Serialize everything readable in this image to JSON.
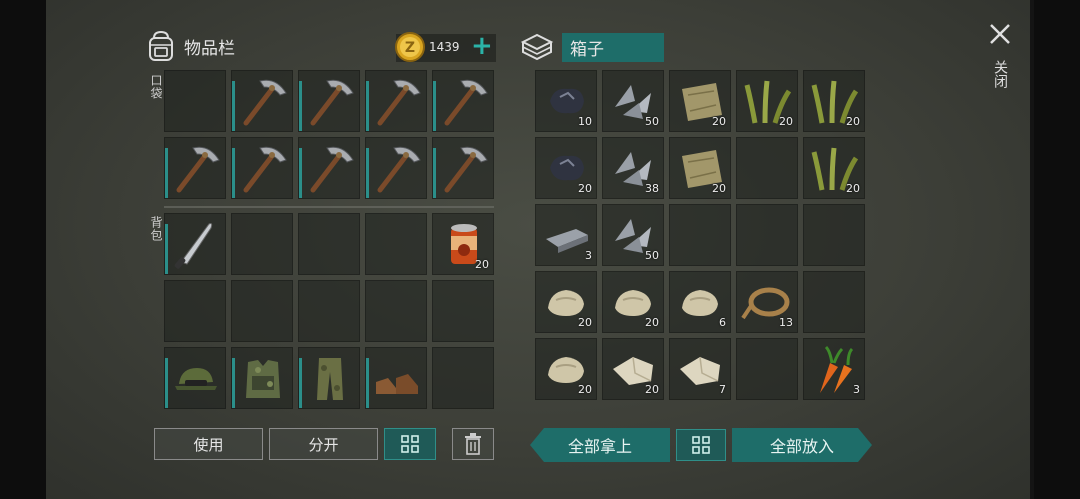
{
  "inventory": {
    "title": "物品栏",
    "currency_amount": "1439",
    "pocket_label": "口袋",
    "backpack_label": "背包",
    "pocket_slots": [
      {
        "item": "empty",
        "qty": ""
      },
      {
        "item": "pickaxe",
        "qty": ""
      },
      {
        "item": "pickaxe",
        "qty": ""
      },
      {
        "item": "pickaxe",
        "qty": ""
      },
      {
        "item": "pickaxe",
        "qty": ""
      },
      {
        "item": "pickaxe",
        "qty": ""
      },
      {
        "item": "pickaxe",
        "qty": ""
      },
      {
        "item": "pickaxe",
        "qty": ""
      },
      {
        "item": "pickaxe",
        "qty": ""
      },
      {
        "item": "pickaxe",
        "qty": ""
      }
    ],
    "backpack_slots": [
      {
        "item": "machete",
        "qty": ""
      },
      {
        "item": "empty",
        "qty": ""
      },
      {
        "item": "empty",
        "qty": ""
      },
      {
        "item": "empty",
        "qty": ""
      },
      {
        "item": "canned-food",
        "qty": "20"
      },
      {
        "item": "empty",
        "qty": ""
      },
      {
        "item": "empty",
        "qty": ""
      },
      {
        "item": "empty",
        "qty": ""
      },
      {
        "item": "empty",
        "qty": ""
      },
      {
        "item": "empty",
        "qty": ""
      },
      {
        "item": "camo-cap",
        "qty": ""
      },
      {
        "item": "camo-vest",
        "qty": ""
      },
      {
        "item": "camo-pants",
        "qty": ""
      },
      {
        "item": "boots",
        "qty": ""
      },
      {
        "item": "empty",
        "qty": ""
      }
    ],
    "use_label": "使用",
    "split_label": "分开"
  },
  "chest": {
    "title": "箱子",
    "slots": [
      {
        "item": "coal",
        "qty": "10"
      },
      {
        "item": "iron-scrap",
        "qty": "50"
      },
      {
        "item": "cloth",
        "qty": "20"
      },
      {
        "item": "plant-fiber",
        "qty": "20"
      },
      {
        "item": "plant-fiber",
        "qty": "20"
      },
      {
        "item": "coal",
        "qty": "20"
      },
      {
        "item": "iron-scrap",
        "qty": "38"
      },
      {
        "item": "cloth",
        "qty": "20"
      },
      {
        "item": "empty",
        "qty": ""
      },
      {
        "item": "plant-fiber",
        "qty": "20"
      },
      {
        "item": "iron-bar",
        "qty": "3"
      },
      {
        "item": "iron-scrap",
        "qty": "50"
      },
      {
        "item": "empty",
        "qty": ""
      },
      {
        "item": "empty",
        "qty": ""
      },
      {
        "item": "empty",
        "qty": ""
      },
      {
        "item": "stone",
        "qty": "20"
      },
      {
        "item": "stone",
        "qty": "20"
      },
      {
        "item": "stone",
        "qty": "6"
      },
      {
        "item": "rope",
        "qty": "13"
      },
      {
        "item": "empty",
        "qty": ""
      },
      {
        "item": "stone",
        "qty": "20"
      },
      {
        "item": "limestone",
        "qty": "20"
      },
      {
        "item": "limestone",
        "qty": "7"
      },
      {
        "item": "empty",
        "qty": ""
      },
      {
        "item": "carrot",
        "qty": "3"
      }
    ],
    "take_all_label": "全部拿上",
    "put_all_label": "全部放入"
  },
  "close_label": "关闭",
  "colors": {
    "accent": "#2b8f8a",
    "teal_button": "#1e6d69"
  }
}
